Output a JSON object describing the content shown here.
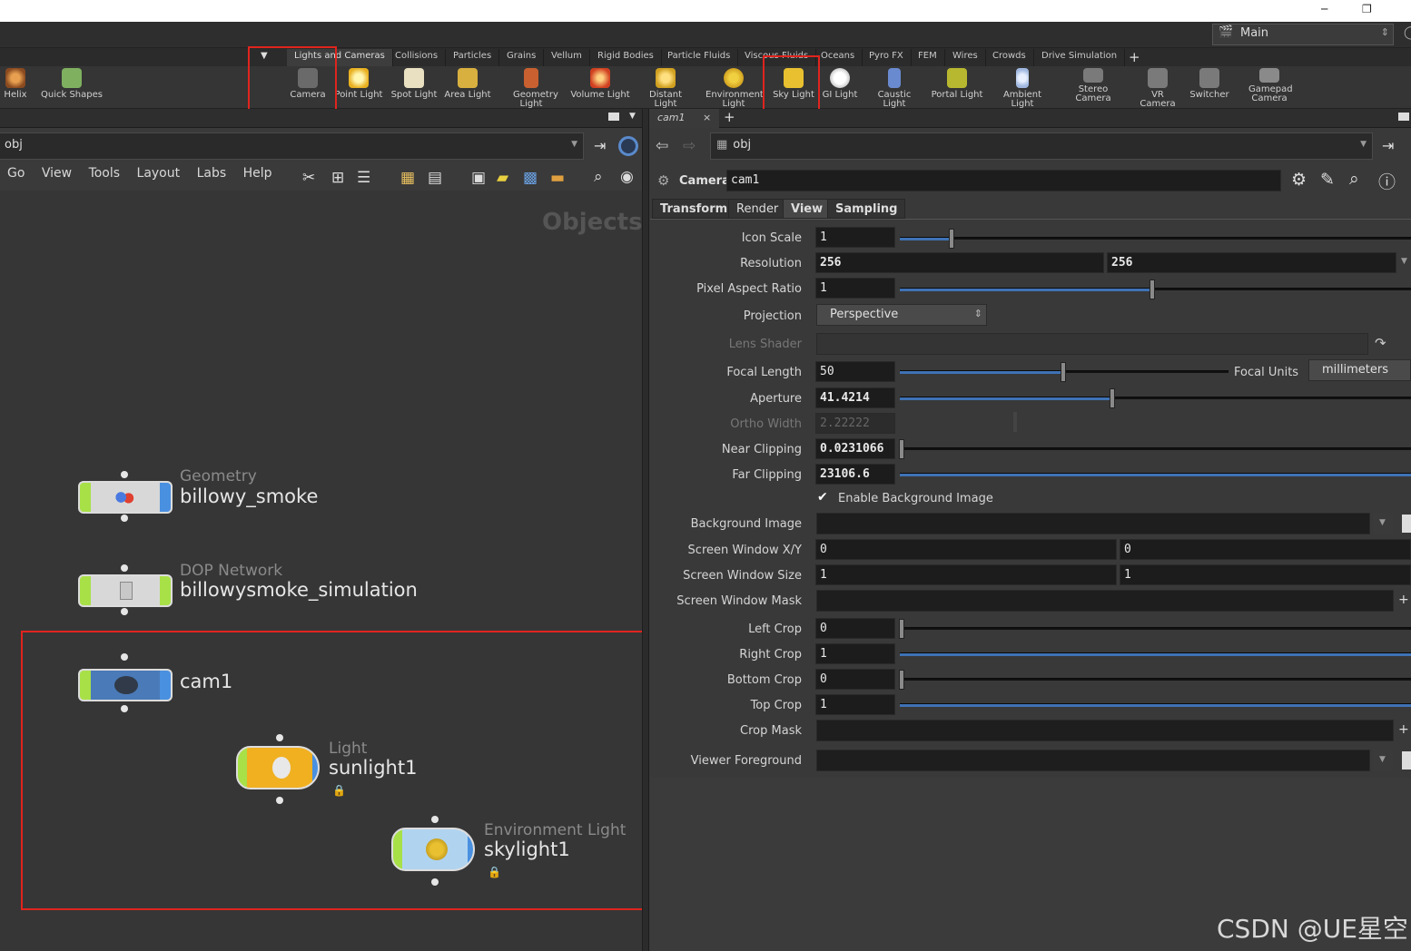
{
  "window": {
    "minimize_icon": "minimize-icon",
    "restore_icon": "restore-icon",
    "desktop": "Main"
  },
  "shelf_tabs": [
    "Lights and Cameras",
    "Collisions",
    "Particles",
    "Grains",
    "Vellum",
    "Rigid Bodies",
    "Particle Fluids",
    "Viscous Fluids",
    "Oceans",
    "Pyro FX",
    "FEM",
    "Wires",
    "Crowds",
    "Drive Simulation"
  ],
  "left_tools": [
    "Helix",
    "Quick Shapes"
  ],
  "tools": [
    "Camera",
    "Point Light",
    "Spot Light",
    "Area Light",
    "Geometry Light",
    "Volume Light",
    "Distant Light",
    "Environment Light",
    "Sky Light",
    "GI Light",
    "Caustic Light",
    "Portal Light",
    "Ambient Light",
    "Stereo Camera",
    "VR Camera",
    "Switcher",
    "Gamepad Camera"
  ],
  "left_pane": {
    "path": "obj",
    "menus": [
      "Go",
      "View",
      "Tools",
      "Layout",
      "Labs",
      "Help"
    ],
    "context_label": "Objects"
  },
  "nodes": [
    {
      "type": "Geometry",
      "name": "billowy_smoke"
    },
    {
      "type": "DOP Network",
      "name": "billowysmoke_simulation"
    },
    {
      "type": "",
      "name": "cam1"
    },
    {
      "type": "Light",
      "name": "sunlight1"
    },
    {
      "type": "Environment Light",
      "name": "skylight1"
    }
  ],
  "right_pane": {
    "tab": "cam1",
    "path": "obj",
    "node_type": "Camera",
    "node_name": "cam1",
    "param_tabs": [
      "Transform",
      "Render",
      "View",
      "Sampling"
    ],
    "active_tab": "View",
    "params": {
      "icon_scale": {
        "label": "Icon Scale",
        "value": "1"
      },
      "resolution": {
        "label": "Resolution",
        "x": "256",
        "y": "256"
      },
      "pixel_aspect": {
        "label": "Pixel Aspect Ratio",
        "value": "1"
      },
      "projection": {
        "label": "Projection",
        "value": "Perspective"
      },
      "lens_shader": {
        "label": "Lens Shader"
      },
      "focal_length": {
        "label": "Focal Length",
        "value": "50"
      },
      "focal_units": {
        "label": "Focal Units",
        "value": "millimeters"
      },
      "aperture": {
        "label": "Aperture",
        "value": "41.4214"
      },
      "ortho_width": {
        "label": "Ortho Width",
        "value": "2.22222"
      },
      "near_clipping": {
        "label": "Near Clipping",
        "value": "0.0231066"
      },
      "far_clipping": {
        "label": "Far Clipping",
        "value": "23106.6"
      },
      "enable_bg": {
        "label": "Enable Background Image",
        "checked": true
      },
      "background_image": {
        "label": "Background Image"
      },
      "screen_window_xy": {
        "label": "Screen Window X/Y",
        "x": "0",
        "y": "0"
      },
      "screen_window_size": {
        "label": "Screen Window Size",
        "x": "1",
        "y": "1"
      },
      "screen_window_mask": {
        "label": "Screen Window Mask"
      },
      "left_crop": {
        "label": "Left Crop",
        "value": "0"
      },
      "right_crop": {
        "label": "Right Crop",
        "value": "1"
      },
      "bottom_crop": {
        "label": "Bottom Crop",
        "value": "0"
      },
      "top_crop": {
        "label": "Top Crop",
        "value": "1"
      },
      "crop_mask": {
        "label": "Crop Mask"
      },
      "viewer_foreground": {
        "label": "Viewer Foreground"
      }
    }
  },
  "watermark": "CSDN @UE星空"
}
